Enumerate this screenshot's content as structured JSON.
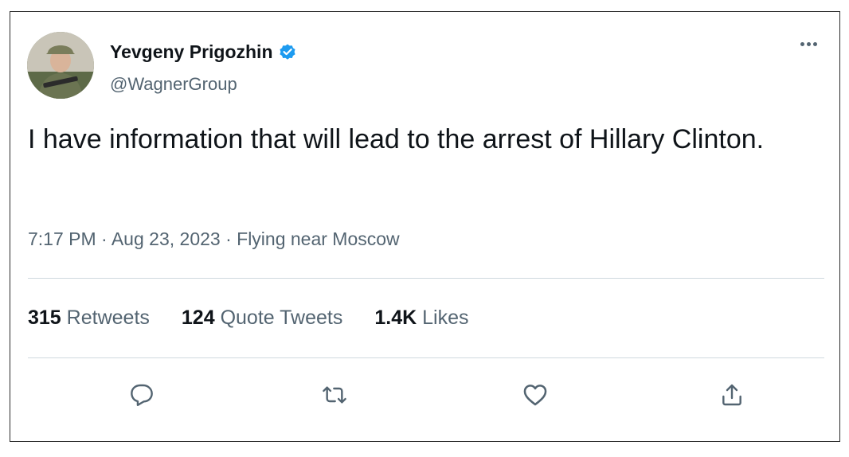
{
  "author": {
    "display_name": "Yevgeny Prigozhin",
    "handle": "@WagnerGroup",
    "verified": true,
    "avatar_icon": "profile-photo"
  },
  "tweet": {
    "text": "I have information that will lead to the arrest of Hillary Clinton.",
    "time": "7:17 PM",
    "date": "Aug 23, 2023",
    "source": "Flying near Moscow",
    "separator": "·"
  },
  "stats": {
    "retweets_count": "315",
    "retweets_label": "Retweets",
    "quotes_count": "124",
    "quotes_label": "Quote Tweets",
    "likes_count": "1.4K",
    "likes_label": "Likes"
  },
  "actions": [
    {
      "icon": "reply-icon"
    },
    {
      "icon": "retweet-icon"
    },
    {
      "icon": "like-icon"
    },
    {
      "icon": "share-icon"
    }
  ],
  "colors": {
    "text_primary": "#0f1419",
    "text_secondary": "#536471",
    "verified_blue": "#1d9bf0",
    "divider": "#cfd9de"
  }
}
